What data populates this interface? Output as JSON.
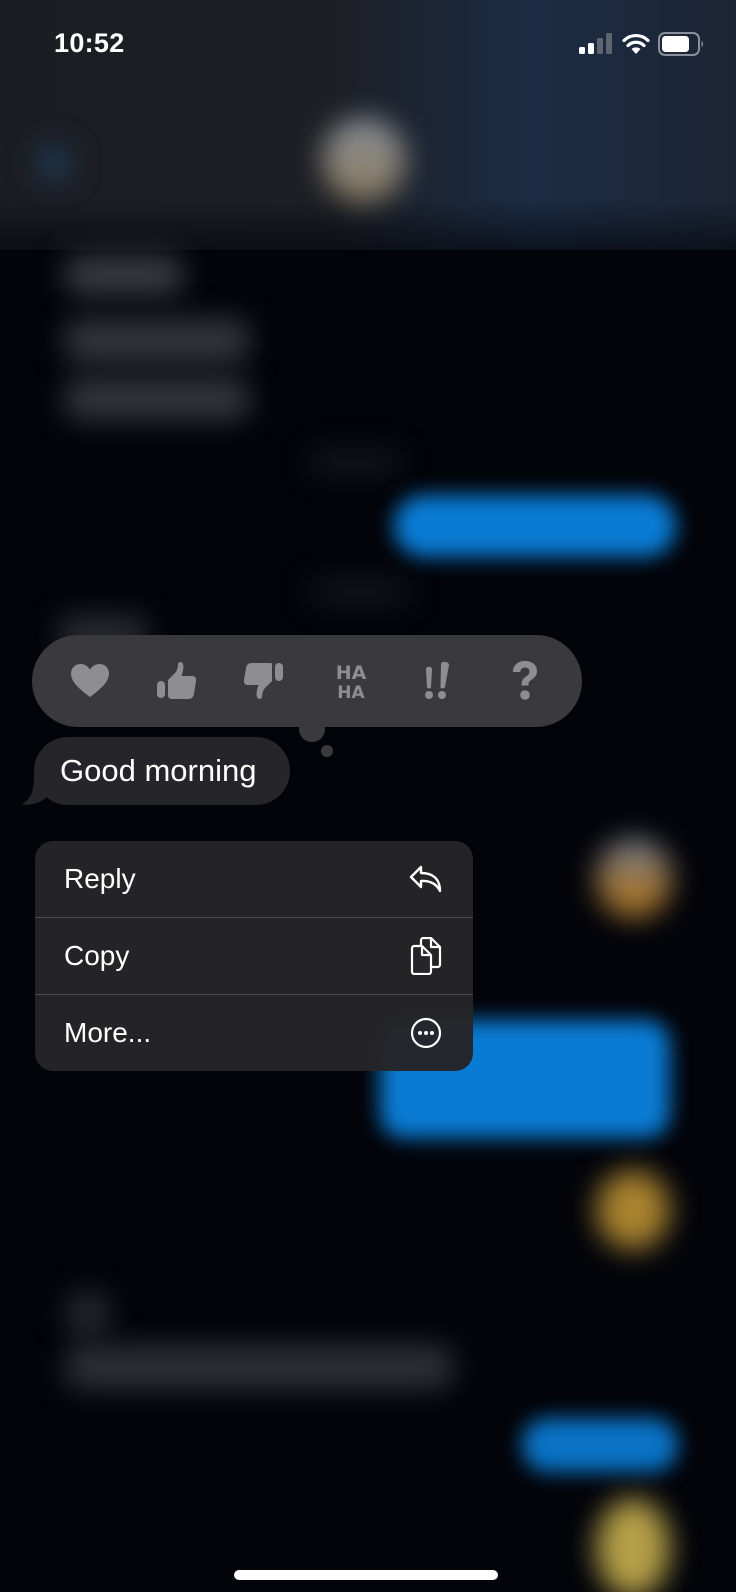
{
  "status_bar": {
    "time": "10:52",
    "signal_bars_active": 2,
    "signal_bars_total": 4,
    "wifi": "wifi-icon",
    "battery_level": 0.7
  },
  "tapback": {
    "reactions": [
      {
        "name": "heart",
        "icon": "heart-icon"
      },
      {
        "name": "thumbs-up",
        "icon": "thumbs-up-icon"
      },
      {
        "name": "thumbs-down",
        "icon": "thumbs-down-icon"
      },
      {
        "name": "haha",
        "icon": "haha-icon",
        "line1": "HA",
        "line2": "HA"
      },
      {
        "name": "emphasize",
        "icon": "double-exclamation-icon",
        "glyph": "!!"
      },
      {
        "name": "question",
        "icon": "question-icon",
        "glyph": "?"
      }
    ],
    "icon_color": "#8e8e92",
    "background": "#3a3a3e"
  },
  "message": {
    "text": "Good morning",
    "bubble_color": "#25252a"
  },
  "context_menu": {
    "items": [
      {
        "label": "Reply",
        "icon": "reply-arrow-icon"
      },
      {
        "label": "Copy",
        "icon": "copy-documents-icon"
      },
      {
        "label": "More...",
        "icon": "ellipsis-circle-icon"
      }
    ]
  },
  "colors": {
    "outgoing_bubble": "#0a7bd4",
    "background": "#03040a"
  }
}
